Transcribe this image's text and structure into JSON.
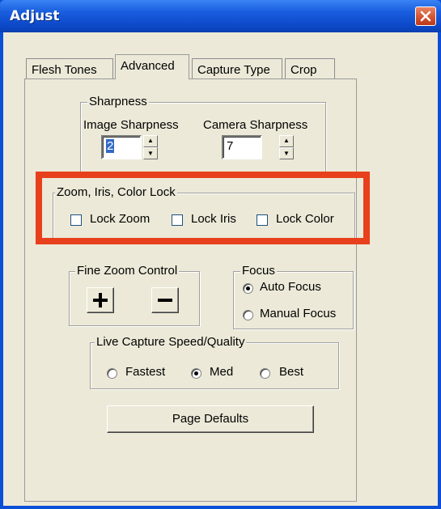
{
  "window": {
    "title": "Adjust",
    "close_icon": "close-icon",
    "titlebar_color": "#1a5fe0",
    "close_color": "#d1502f"
  },
  "tabs": [
    {
      "label": "Flesh Tones",
      "active": false
    },
    {
      "label": "Advanced",
      "active": true
    },
    {
      "label": "Capture Type",
      "active": false
    },
    {
      "label": "Crop",
      "active": false
    }
  ],
  "sharpness": {
    "group_label": "Sharpness",
    "image_label": "Image Sharpness",
    "image_value": "2",
    "camera_label": "Camera Sharpness",
    "camera_value": "7"
  },
  "lock": {
    "group_label": "Zoom, Iris, Color Lock",
    "zoom_label": "Lock Zoom",
    "iris_label": "Lock Iris",
    "color_label": "Lock Color",
    "zoom_checked": false,
    "iris_checked": false,
    "color_checked": false,
    "highlight_color": "#e8401c"
  },
  "fine_zoom": {
    "group_label": "Fine Zoom Control",
    "plus_icon": "plus-icon",
    "minus_icon": "minus-icon"
  },
  "focus": {
    "group_label": "Focus",
    "auto_label": "Auto Focus",
    "manual_label": "Manual Focus",
    "selected": "Auto Focus"
  },
  "capture": {
    "group_label": "Live Capture Speed/Quality",
    "fastest_label": "Fastest",
    "med_label": "Med",
    "best_label": "Best",
    "selected": "Med"
  },
  "page_defaults_label": "Page Defaults"
}
